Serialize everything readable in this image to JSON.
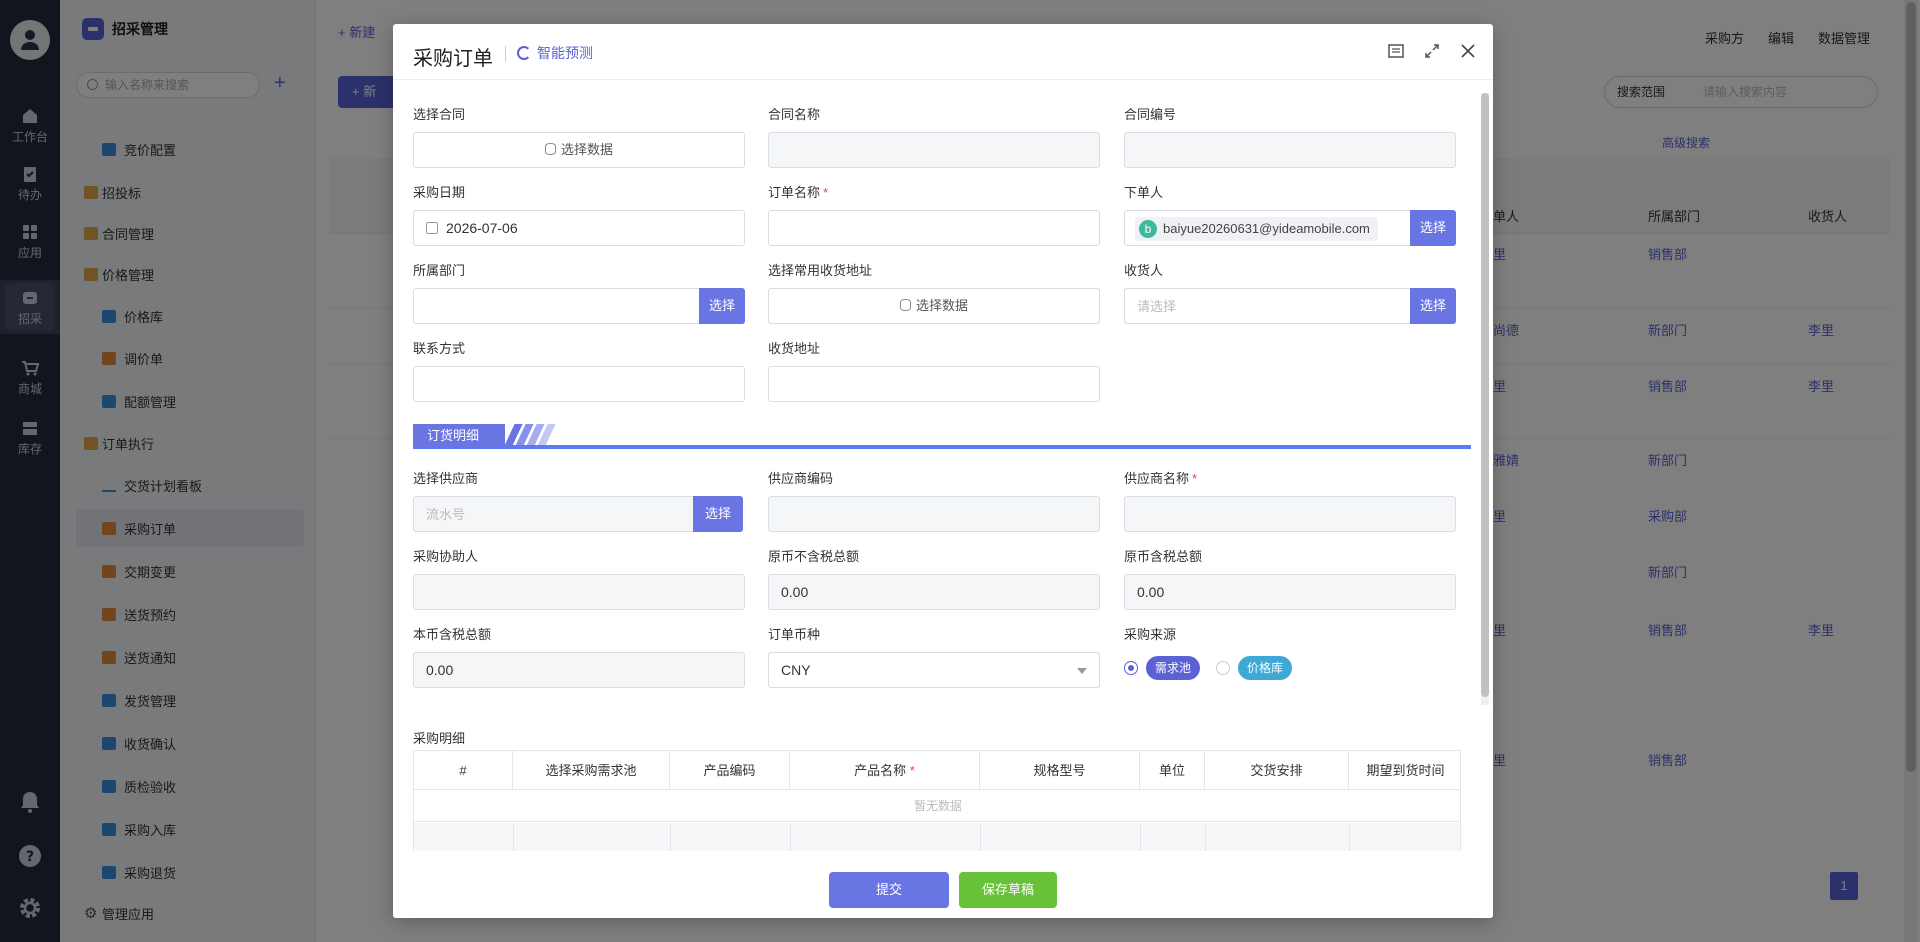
{
  "rail": {
    "items": [
      {
        "label": "工作台",
        "icon": "home-icon"
      },
      {
        "label": "待办",
        "icon": "clipboard-icon"
      },
      {
        "label": "应用",
        "icon": "apps-icon"
      },
      {
        "label": "招采",
        "icon": "procurement-icon"
      },
      {
        "label": "商城",
        "icon": "cart-icon"
      },
      {
        "label": "库存",
        "icon": "warehouse-icon"
      }
    ]
  },
  "sidebar": {
    "title": "招采管理",
    "search_placeholder": "输入名称来搜索",
    "items": [
      {
        "label": "竞价配置"
      },
      {
        "label": "招投标"
      },
      {
        "label": "合同管理"
      },
      {
        "label": "价格管理"
      },
      {
        "label": "价格库"
      },
      {
        "label": "调价单"
      },
      {
        "label": "配额管理"
      },
      {
        "label": "订单执行"
      },
      {
        "label": "交货计划看板"
      },
      {
        "label": "采购订单"
      },
      {
        "label": "交期变更"
      },
      {
        "label": "送货预约"
      },
      {
        "label": "送货通知"
      },
      {
        "label": "发货管理"
      },
      {
        "label": "收货确认"
      },
      {
        "label": "质检验收"
      },
      {
        "label": "采购入库"
      },
      {
        "label": "采购退货"
      }
    ],
    "manage_label": "管理应用"
  },
  "background": {
    "tab_new": "+ 新建",
    "top_right": [
      "采购方",
      "编辑",
      "数据管理"
    ],
    "new_button": "+ 新",
    "search_scope": "搜索范围",
    "search_placeholder": "请输入搜索内容",
    "advanced": "高级搜索",
    "columns": [
      "单人",
      "所属部门",
      "收货人"
    ],
    "rows": [
      {
        "person": "里",
        "dept": "销售部",
        "recv": ""
      },
      {
        "person": "尚德",
        "dept": "新部门",
        "recv": "李里"
      },
      {
        "person": "里",
        "dept": "销售部",
        "recv": "李里"
      },
      {
        "person": "雅婧",
        "dept": "新部门",
        "recv": ""
      },
      {
        "person": "里",
        "dept": "采购部",
        "recv": ""
      },
      {
        "person": "",
        "dept": "新部门",
        "recv": ""
      },
      {
        "person": "里",
        "dept": "销售部",
        "recv": "李里"
      },
      {
        "person": "里",
        "dept": "销售部",
        "recv": ""
      }
    ],
    "page": "1"
  },
  "modal": {
    "title": "采购订单",
    "ai_label": "智能预测",
    "fields": {
      "contract_select": {
        "label": "选择合同",
        "button": "选择数据"
      },
      "contract_name": {
        "label": "合同名称",
        "value": ""
      },
      "contract_no": {
        "label": "合同编号",
        "value": ""
      },
      "purchase_date": {
        "label": "采购日期",
        "value": "2026-07-06"
      },
      "order_name": {
        "label": "订单名称",
        "value": ""
      },
      "orderer": {
        "label": "下单人",
        "value": "baiyue20260631@yideamobile.com",
        "avatar": "b"
      },
      "dept": {
        "label": "所属部门",
        "value": ""
      },
      "address_select": {
        "label": "选择常用收货地址",
        "button": "选择数据"
      },
      "receiver": {
        "label": "收货人",
        "placeholder": "请选择"
      },
      "contact": {
        "label": "联系方式",
        "value": ""
      },
      "address": {
        "label": "收货地址",
        "value": ""
      },
      "supplier_select": {
        "label": "选择供应商",
        "placeholder": "流水号"
      },
      "supplier_code": {
        "label": "供应商编码",
        "value": ""
      },
      "supplier_name": {
        "label": "供应商名称",
        "value": ""
      },
      "assistant": {
        "label": "采购协助人",
        "value": ""
      },
      "orig_excl_tax": {
        "label": "原币不含税总额",
        "value": "0.00"
      },
      "orig_incl_tax": {
        "label": "原币含税总额",
        "value": "0.00"
      },
      "local_incl_tax": {
        "label": "本币含税总额",
        "value": "0.00"
      },
      "currency": {
        "label": "订单币种",
        "value": "CNY"
      },
      "source": {
        "label": "采购来源",
        "options": [
          "需求池",
          "价格库"
        ]
      }
    },
    "pick_label": "选择",
    "section_title": "订货明细",
    "detail_label": "采购明细",
    "detail_columns": [
      "#",
      "选择采购需求池",
      "产品编码",
      "产品名称",
      "规格型号",
      "单位",
      "交货安排",
      "期望到货时间"
    ],
    "empty_text": "暂无数据",
    "submit": "提交",
    "save_draft": "保存草稿",
    "colors": {
      "accent": "#6a75e4",
      "green": "#67c23a",
      "pill_blue": "#5b62d6",
      "pill_cyan": "#3fa9d6"
    }
  }
}
